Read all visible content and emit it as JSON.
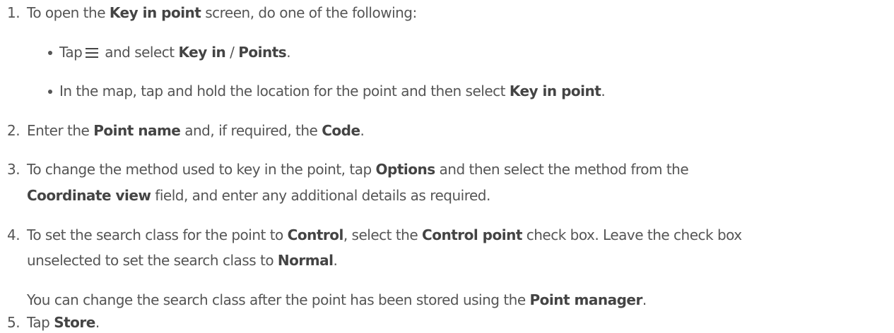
{
  "steps": {
    "s1": {
      "num": "1.",
      "t1": "To open the ",
      "b1": "Key in point",
      "t2": " screen, do one of the following:",
      "bullets": {
        "a": {
          "t1": "Tap",
          "icon": "menu-icon",
          "t2": " and select ",
          "b1": "Key in",
          "t3": " / ",
          "b2": "Points",
          "t4": "."
        },
        "b": {
          "t1": "In the map, tap and hold the location for the point and then select ",
          "b1": "Key in point",
          "t2": "."
        }
      }
    },
    "s2": {
      "num": "2.",
      "t1": "Enter the ",
      "b1": "Point name",
      "t2": " and, if required, the ",
      "b2": "Code",
      "t3": "."
    },
    "s3": {
      "num": "3.",
      "t1": "To change the method used to key in the point, tap ",
      "b1": "Options",
      "t2": " and then select the method from the",
      "b2": "Coordinate view",
      "t3": " field, and enter any additional details as required."
    },
    "s4": {
      "num": "4.",
      "t1": "To set the search class for the point to ",
      "b1": "Control",
      "t2": ", select the ",
      "b2": "Control point",
      "t3": " check box. Leave the check box",
      "t4": "unselected to set the search class to ",
      "b3": "Normal",
      "t5": ".",
      "note_t1": "You can change the search class after the point has been stored using the ",
      "note_b1": "Point manager",
      "note_t2": "."
    },
    "s5": {
      "num": "5.",
      "t1": "Tap ",
      "b1": "Store",
      "t2": "."
    }
  }
}
